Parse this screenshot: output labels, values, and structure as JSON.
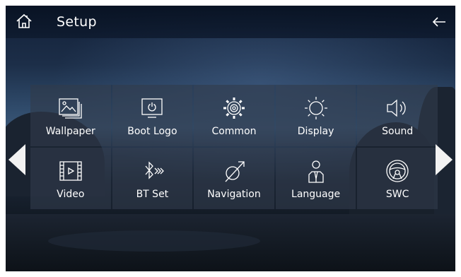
{
  "header": {
    "title": "Setup",
    "home_icon": "home-icon",
    "back_icon": "back-arrow-icon"
  },
  "menu": {
    "items": [
      {
        "label": "Wallpaper",
        "icon": "wallpaper-icon"
      },
      {
        "label": "Boot Logo",
        "icon": "boot-logo-icon"
      },
      {
        "label": "Common",
        "icon": "gear-icon"
      },
      {
        "label": "Display",
        "icon": "brightness-icon"
      },
      {
        "label": "Sound",
        "icon": "speaker-icon"
      },
      {
        "label": "Video",
        "icon": "video-icon"
      },
      {
        "label": "BT Set",
        "icon": "bluetooth-icon"
      },
      {
        "label": "Navigation",
        "icon": "navigation-icon"
      },
      {
        "label": "Language",
        "icon": "language-icon"
      },
      {
        "label": "SWC",
        "icon": "steering-wheel-icon"
      }
    ]
  },
  "paging": {
    "prev_icon": "page-left-icon",
    "next_icon": "page-right-icon"
  },
  "colors": {
    "accent": "#ffffff",
    "tile_bg": "#3c4655"
  }
}
